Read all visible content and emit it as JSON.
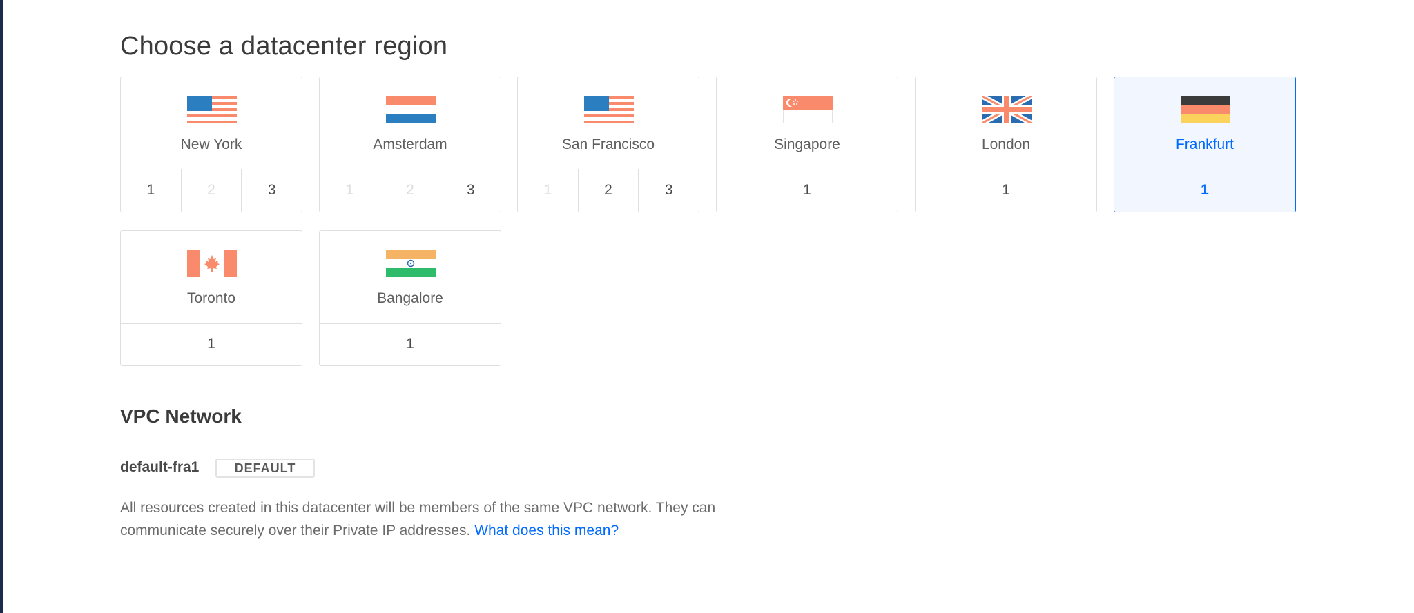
{
  "page": {
    "title": "Choose a datacenter region"
  },
  "regions": [
    {
      "city": "New York",
      "flag": "us-flag-icon",
      "selected": false,
      "datacenters": [
        {
          "label": "1",
          "enabled": true
        },
        {
          "label": "2",
          "enabled": false
        },
        {
          "label": "3",
          "enabled": true
        }
      ]
    },
    {
      "city": "Amsterdam",
      "flag": "netherlands-flag-icon",
      "selected": false,
      "datacenters": [
        {
          "label": "1",
          "enabled": false
        },
        {
          "label": "2",
          "enabled": false
        },
        {
          "label": "3",
          "enabled": true
        }
      ]
    },
    {
      "city": "San Francisco",
      "flag": "us-flag-icon",
      "selected": false,
      "datacenters": [
        {
          "label": "1",
          "enabled": false
        },
        {
          "label": "2",
          "enabled": true
        },
        {
          "label": "3",
          "enabled": true
        }
      ]
    },
    {
      "city": "Singapore",
      "flag": "singapore-flag-icon",
      "selected": false,
      "datacenters": [
        {
          "label": "1",
          "enabled": true
        }
      ]
    },
    {
      "city": "London",
      "flag": "uk-flag-icon",
      "selected": false,
      "datacenters": [
        {
          "label": "1",
          "enabled": true
        }
      ]
    },
    {
      "city": "Frankfurt",
      "flag": "germany-flag-icon",
      "selected": true,
      "datacenters": [
        {
          "label": "1",
          "enabled": true
        }
      ]
    },
    {
      "city": "Toronto",
      "flag": "canada-flag-icon",
      "selected": false,
      "datacenters": [
        {
          "label": "1",
          "enabled": true
        }
      ]
    },
    {
      "city": "Bangalore",
      "flag": "india-flag-icon",
      "selected": false,
      "datacenters": [
        {
          "label": "1",
          "enabled": true
        }
      ]
    }
  ],
  "vpc": {
    "heading": "VPC Network",
    "network_name": "default-fra1",
    "badge": "DEFAULT",
    "description": "All resources created in this datacenter will be members of the same VPC network. They can communicate securely over their Private IP addresses.",
    "link_text": "What does this mean?"
  },
  "colors": {
    "accent": "#0069ff",
    "selected_background": "#f2f7ff",
    "border": "#dfdfdf",
    "disabled_text": "#dcdcdc"
  }
}
